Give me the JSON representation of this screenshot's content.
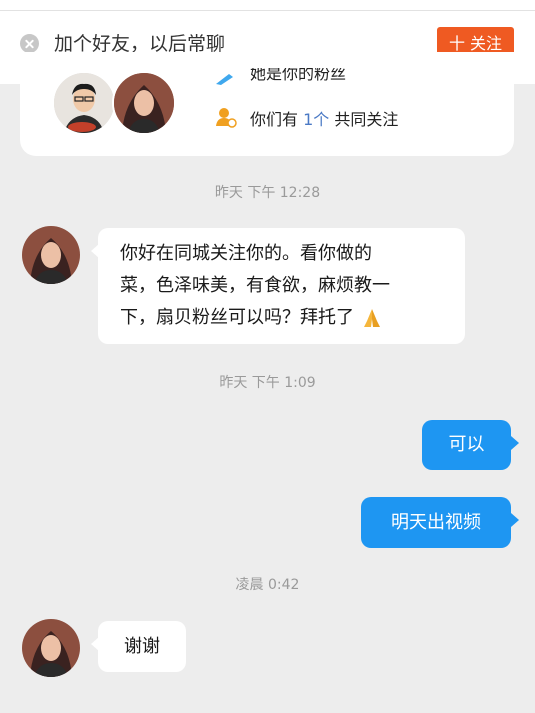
{
  "banner": {
    "text": "加个好友，以后常聊",
    "follow_button": "十 关注"
  },
  "info_card": {
    "fan_text": "她是你的粉丝",
    "mutual_prefix": "你们有 ",
    "mutual_count": "1个",
    "mutual_suffix": " 共同关注"
  },
  "messages": [
    {
      "type": "time",
      "text": "昨天 下午 12:28"
    },
    {
      "type": "incoming",
      "lines": [
        "你好在同城关注你的。看你做的",
        "菜，色泽味美，有食欲，麻烦教一",
        "下，扇贝粉丝可以吗？拜托了"
      ],
      "emoji": "folded-hands-icon"
    },
    {
      "type": "time",
      "text": "昨天 下午 1:09"
    },
    {
      "type": "outgoing",
      "text": "可以"
    },
    {
      "type": "outgoing",
      "text": "明天出视频"
    },
    {
      "type": "time",
      "text": "凌晨 0:42"
    },
    {
      "type": "incoming",
      "lines": [
        "谢谢"
      ]
    }
  ],
  "colors": {
    "accent": "#ef5a22",
    "outgoing_bubble": "#1e96f2",
    "background": "#ededed",
    "link": "#4a79c5"
  }
}
